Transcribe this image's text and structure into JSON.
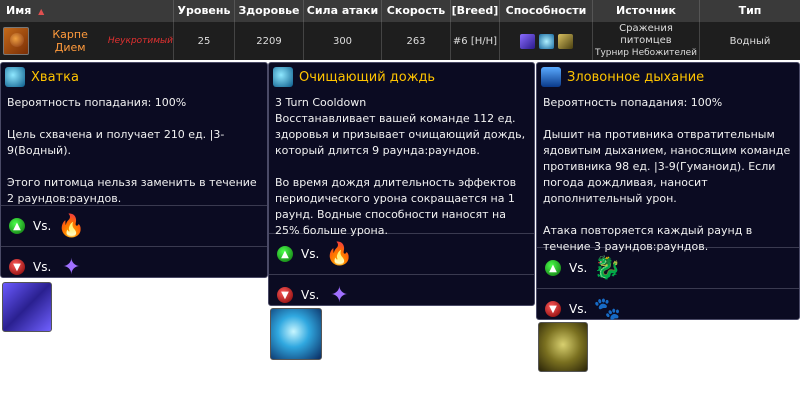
{
  "table": {
    "headers": {
      "name": "Имя",
      "level": "Уровень",
      "health": "Здоровье",
      "power": "Сила атаки",
      "speed": "Скорость",
      "breed": "[Breed]",
      "abilities": "Способности",
      "source": "Источник",
      "type": "Тип"
    },
    "sort_indicator": "▲",
    "row": {
      "name": "Карпе Дием",
      "quality": "Неукротимый",
      "level": "25",
      "health": "2209",
      "power": "300",
      "speed": "263",
      "breed": "#6 [H/H]",
      "source_line1": "Сражения питомцев",
      "source_line2": "Турнир Небожителей",
      "type": "Водный"
    }
  },
  "tooltips": [
    {
      "title": "Хватка",
      "body": "Вероятность попадания: 100%\n\nЦель схвачена и получает 210 ед. |3-9(Водный).\n\nЭтого питомца нельзя заменить в течение 2 раундов:раундов.",
      "vs_label": "Vs.",
      "strong_icon": "fire-icon",
      "weak_icon": "magic-star-icon"
    },
    {
      "title": "Очищающий дождь",
      "body": "3 Turn Cooldown\nВосстанавливает вашей команде 112 ед. здоровья и призывает очищающий дождь, который длится 9 раунда:раундов.\n\nВо время дождя длительность эффектов периодического урона сокращается на 1 раунд. Водные способности наносят на 25% больше урона.",
      "vs_label": "Vs.",
      "strong_icon": "fire-icon",
      "weak_icon": "magic-star-icon"
    },
    {
      "title": "Зловонное дыхание",
      "body": "Вероятность попадания: 100%\n\nДышит на противника отвратительным ядовитым дыханием, наносящим команде противника 98 ед. |3-9(Гуманоид). Если погода дождливая, наносит дополнительный урон.\n\nАтака повторяется каждый раунд в течение 3 раундов:раундов.",
      "vs_label": "Vs.",
      "strong_icon": "dragon-icon",
      "weak_icon": "paw-icon"
    }
  ],
  "colors": {
    "header_bg": "#3a3a3a",
    "row_bg": "#1e1e1e",
    "tooltip_bg": "#0b0b22",
    "title_gold": "#ffc400",
    "pet_name": "#ff9a3c",
    "quality_red": "#e03030"
  }
}
